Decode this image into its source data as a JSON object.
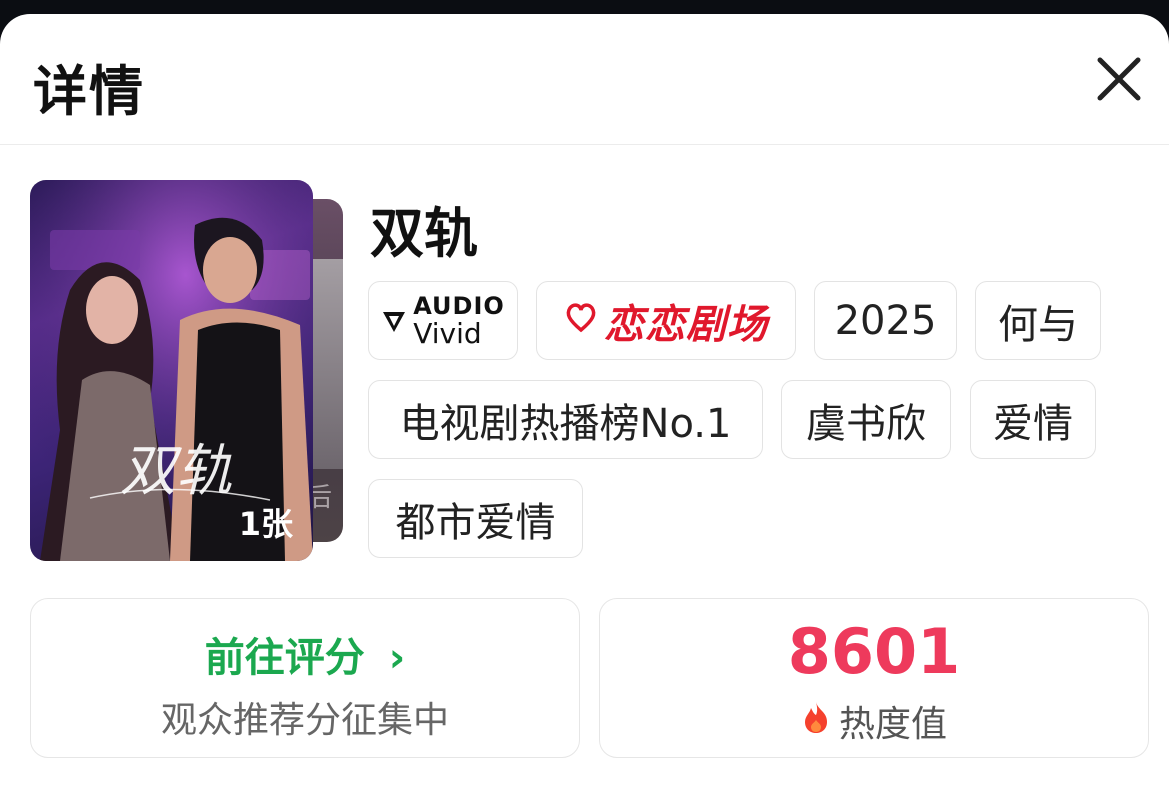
{
  "header": {
    "title": "详情"
  },
  "poster": {
    "overlay_title": "双轨",
    "count_label": "1张"
  },
  "show": {
    "name": "双轨"
  },
  "tags": {
    "audio_badge": {
      "line1": "AUDIO",
      "line2": "Vivid"
    },
    "brand_badge": "恋恋剧场",
    "year": "2025",
    "director": "何与",
    "ranking": "电视剧热播榜No.1",
    "actor": "虞书欣",
    "genre": "爱情",
    "subgenre": "都市爱情"
  },
  "rating_card": {
    "action_label": "前往评分",
    "chevron": "›",
    "subtitle": "观众推荐分征集中"
  },
  "heat_card": {
    "value": "8601",
    "label": "热度值"
  },
  "colors": {
    "accent_green": "#1ba84f",
    "heat_red": "#ee3a5c",
    "brand_red": "#e0182c"
  }
}
